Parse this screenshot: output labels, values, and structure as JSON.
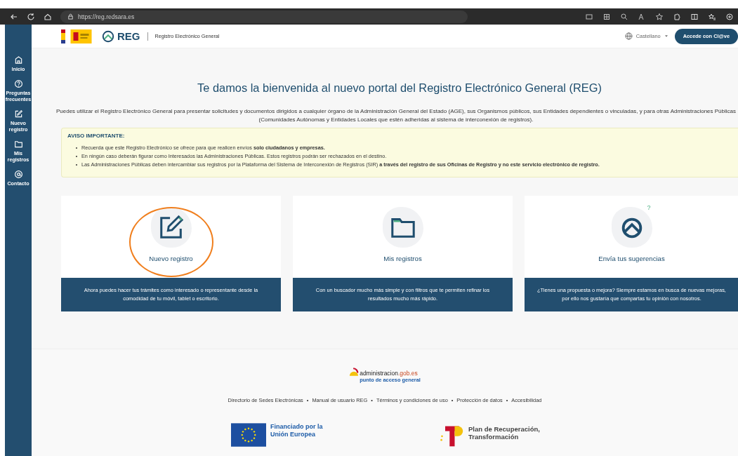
{
  "browser": {
    "url": "https://reg.redsara.es"
  },
  "header": {
    "logo_text": "REG",
    "subtitle": "Registro Electrónico General",
    "language": "Castellano",
    "login_button": "Accede con Cl@ve"
  },
  "sidebar": {
    "items": [
      {
        "kind": "home",
        "label": "Inicio"
      },
      {
        "kind": "help",
        "label": "Preguntas frecuentes"
      },
      {
        "kind": "edit",
        "label": "Nuevo registro"
      },
      {
        "kind": "folder",
        "label": "Mis registros"
      },
      {
        "kind": "at",
        "label": "Contacto"
      }
    ]
  },
  "welcome": {
    "title": "Te damos la bienvenida al nuevo portal del Registro Electrónico General (REG)",
    "intro": "Puedes utilizar el Registro Electrónico General para presentar solicitudes y documentos dirigidos a cualquier órgano de la Administración General del Estado (AGE), sus Organismos públicos, sus Entidades dependientes o vinculadas, y para otras Administraciones Públicas (Comunidades Autónomas y Entidades Locales que estén adheridas al sistema de interconexión de registros)."
  },
  "notice": {
    "title": "AVISO IMPORTANTE:",
    "items": [
      "Recuerda que este Registro Electrónico se ofrece para que realicen envíos **solo ciudadanos y empresas.**",
      "En ningún caso deberán figurar como Interesados las Administraciones Públicas. Estos registros podrán ser rechazados en el destino.",
      "Las Administraciones Públicas deben intercambiar sus registros por la Plataforma del Sistema de Interconexión de Registros (SIR) **a través del registro de sus Oficinas de Registro y no este servicio electrónico de registro.**"
    ]
  },
  "cards": [
    {
      "kind": "edit",
      "title": "Nuevo registro",
      "description": "Ahora puedes hacer tus trámites como interesado o representante desde la comodidad de tu móvil, tablet o escritorio.",
      "highlighted": true
    },
    {
      "kind": "folder",
      "title": "Mis registros",
      "description": "Con un buscador mucho más simple y con filtros que te permiten refinar los resultados mucho más rápido.",
      "highlighted": false
    },
    {
      "kind": "feedback",
      "badge": "?",
      "title": "Envía tus sugerencias",
      "description": "¿Tienes una propuesta o mejora? Siempre estamos en busca de nuevas mejoras, por ello nos gustaría que compartas tu opinión con nosotros.",
      "highlighted": false
    }
  ],
  "footer": {
    "portal_logo": {
      "name": "administracion",
      "domain": ".gob.es",
      "tagline": "punto de acceso general"
    },
    "separator": "•",
    "links": [
      "Directorio de Sedes Electrónicas",
      "Manual de usuario REG",
      "Términos y condiciones de uso",
      "Protección de datos",
      "Accesibilidad"
    ],
    "eu_funding": "Financiado por la Unión Europea",
    "recovery_plan": "Plan de Recuperación, Transformación"
  }
}
